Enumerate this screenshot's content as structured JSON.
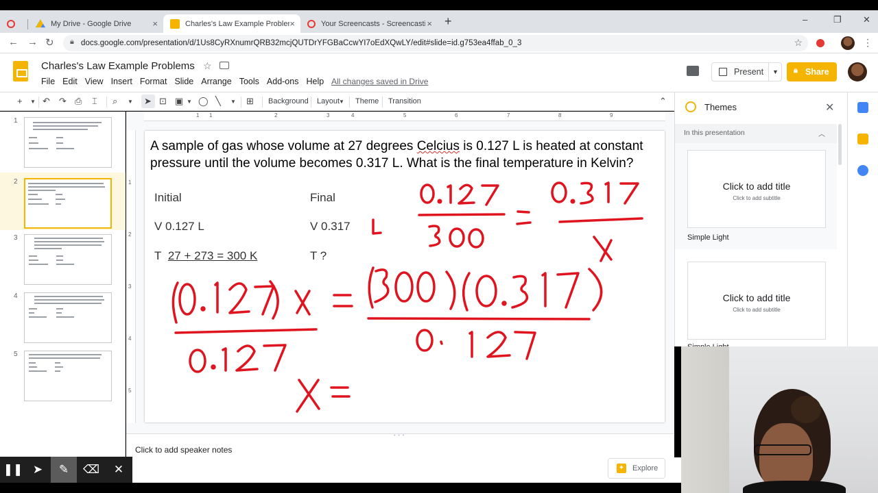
{
  "browser": {
    "tabs": [
      {
        "title": "My Drive - Google Drive",
        "active": false,
        "close": "×"
      },
      {
        "title": "Charles's Law Example Problems",
        "active": true,
        "close": "×"
      },
      {
        "title": "Your Screencasts - Screencastify",
        "active": false,
        "close": "×"
      }
    ],
    "new_tab": "+",
    "window_controls": [
      "–",
      "❐",
      "✕"
    ],
    "url": "docs.google.com/presentation/d/1Us8CyRXnumrQRB32mcjQUTDrYFGBaCcwYI7oEdXQwLY/edit#slide=id.g753ea4ffab_0_3"
  },
  "doc": {
    "title": "Charles's Law Example Problems",
    "menu": [
      "File",
      "Edit",
      "View",
      "Insert",
      "Format",
      "Slide",
      "Arrange",
      "Tools",
      "Add-ons",
      "Help"
    ],
    "saved_status": "All changes saved in Drive",
    "present_label": "Present",
    "share_label": "Share"
  },
  "toolbar": {
    "background": "Background",
    "layout": "Layout",
    "theme": "Theme",
    "transition": "Transition"
  },
  "filmstrip": {
    "numbers": [
      "1",
      "2",
      "3",
      "4",
      "5"
    ],
    "selected": 2
  },
  "ruler": {
    "h": [
      "1",
      "1",
      "2",
      "3",
      "4",
      "5",
      "6",
      "7",
      "8",
      "9"
    ],
    "v": [
      "1",
      "2",
      "3",
      "4",
      "5"
    ]
  },
  "slide": {
    "question_pre": "A sample of gas whose volume at 27 degrees ",
    "question_misspelled": "Celcius",
    "question_post": " is 0.127 L is heated at constant pressure until the volume becomes 0.317 L.  What is the final temperature in Kelvin?",
    "initial_label": "Initial",
    "final_label": "Final",
    "v_initial": "V 0.127 L",
    "v_final": "V  0.317",
    "t_initial_prefix": "T",
    "t_initial_value": "27 + 273 = 300 K",
    "t_final": "T  ?",
    "ink_color": "#e0141e"
  },
  "notes": {
    "placeholder": "Click to add speaker notes"
  },
  "explore_label": "Explore",
  "themes_panel": {
    "title": "Themes",
    "section": "In this presentation",
    "cards": [
      {
        "title": "Click to add title",
        "subtitle": "Click to add subtitle",
        "name": "Simple Light"
      },
      {
        "title": "Click to add title",
        "subtitle": "Click to add subtitle",
        "name": "Simple Light"
      }
    ]
  },
  "screencastify": {
    "buttons": [
      "pause-icon",
      "cursor-icon",
      "pen-icon",
      "eraser-icon",
      "close-icon"
    ]
  },
  "colors": {
    "slides_yellow": "#f4b400",
    "selection_bg": "#fef7e0"
  }
}
